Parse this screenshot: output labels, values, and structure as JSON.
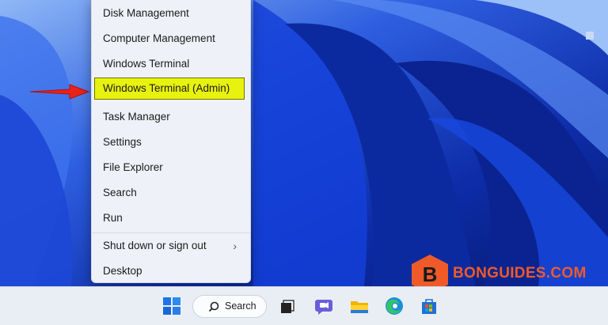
{
  "context_menu": {
    "items": [
      {
        "label": "Disk Management"
      },
      {
        "label": "Computer Management"
      },
      {
        "label": "Windows Terminal"
      },
      {
        "label": "Windows Terminal (Admin)",
        "highlighted": true
      },
      {
        "label": "Task Manager"
      },
      {
        "label": "Settings"
      },
      {
        "label": "File Explorer"
      },
      {
        "label": "Search"
      },
      {
        "label": "Run"
      },
      {
        "label": "Shut down or sign out",
        "submenu": true
      },
      {
        "label": "Desktop"
      }
    ],
    "highlight_color": "#e8f20f"
  },
  "annotation": {
    "arrow_color": "#e8231a"
  },
  "watermark": {
    "text": "BONGUIDES.COM",
    "color": "#f05a28"
  },
  "taskbar": {
    "search_label": "Search",
    "icons": [
      "windows-start-icon",
      "search-icon",
      "task-view-icon",
      "chat-icon",
      "file-explorer-icon",
      "edge-icon",
      "store-icon"
    ]
  }
}
